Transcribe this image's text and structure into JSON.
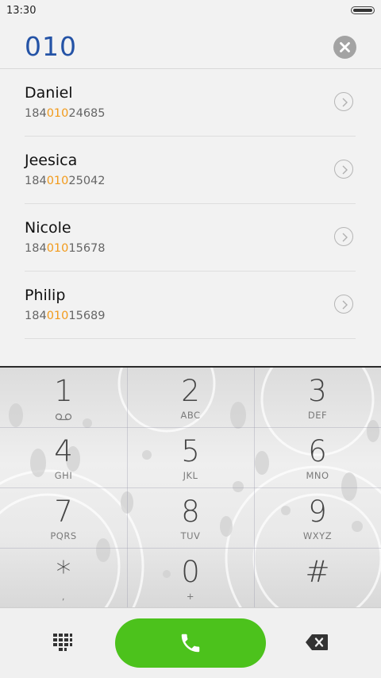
{
  "status_bar": {
    "time": "13:30"
  },
  "dial": {
    "number": "010"
  },
  "contacts": [
    {
      "name": "Daniel",
      "number_prefix": "184",
      "number_match": "010",
      "number_suffix": "24685"
    },
    {
      "name": "Jeesica",
      "number_prefix": "184",
      "number_match": "010",
      "number_suffix": "25042"
    },
    {
      "name": "Nicole",
      "number_prefix": "184",
      "number_match": "010",
      "number_suffix": "15678"
    },
    {
      "name": "Philip",
      "number_prefix": "184",
      "number_match": "010",
      "number_suffix": "15689"
    }
  ],
  "keypad": {
    "keys": [
      {
        "digit": "1",
        "letters": ""
      },
      {
        "digit": "2",
        "letters": "ABC"
      },
      {
        "digit": "3",
        "letters": "DEF"
      },
      {
        "digit": "4",
        "letters": "GHI"
      },
      {
        "digit": "5",
        "letters": "JKL"
      },
      {
        "digit": "6",
        "letters": "MNO"
      },
      {
        "digit": "7",
        "letters": "PQRS"
      },
      {
        "digit": "8",
        "letters": "TUV"
      },
      {
        "digit": "9",
        "letters": "WXYZ"
      },
      {
        "digit": "*",
        "letters": ","
      },
      {
        "digit": "0",
        "letters": "+"
      },
      {
        "digit": "#",
        "letters": ""
      }
    ]
  },
  "icons": {
    "clear": "clear-icon",
    "detail": "chevron-right-icon",
    "voicemail": "voicemail-icon",
    "dialpad": "dialpad-icon",
    "call": "phone-icon",
    "backspace": "backspace-icon"
  },
  "colors": {
    "dialed_number": "#2453a6",
    "match_highlight": "#f29a1a",
    "call_button": "#4cc21c",
    "clear_button": "#a3a3a3"
  }
}
